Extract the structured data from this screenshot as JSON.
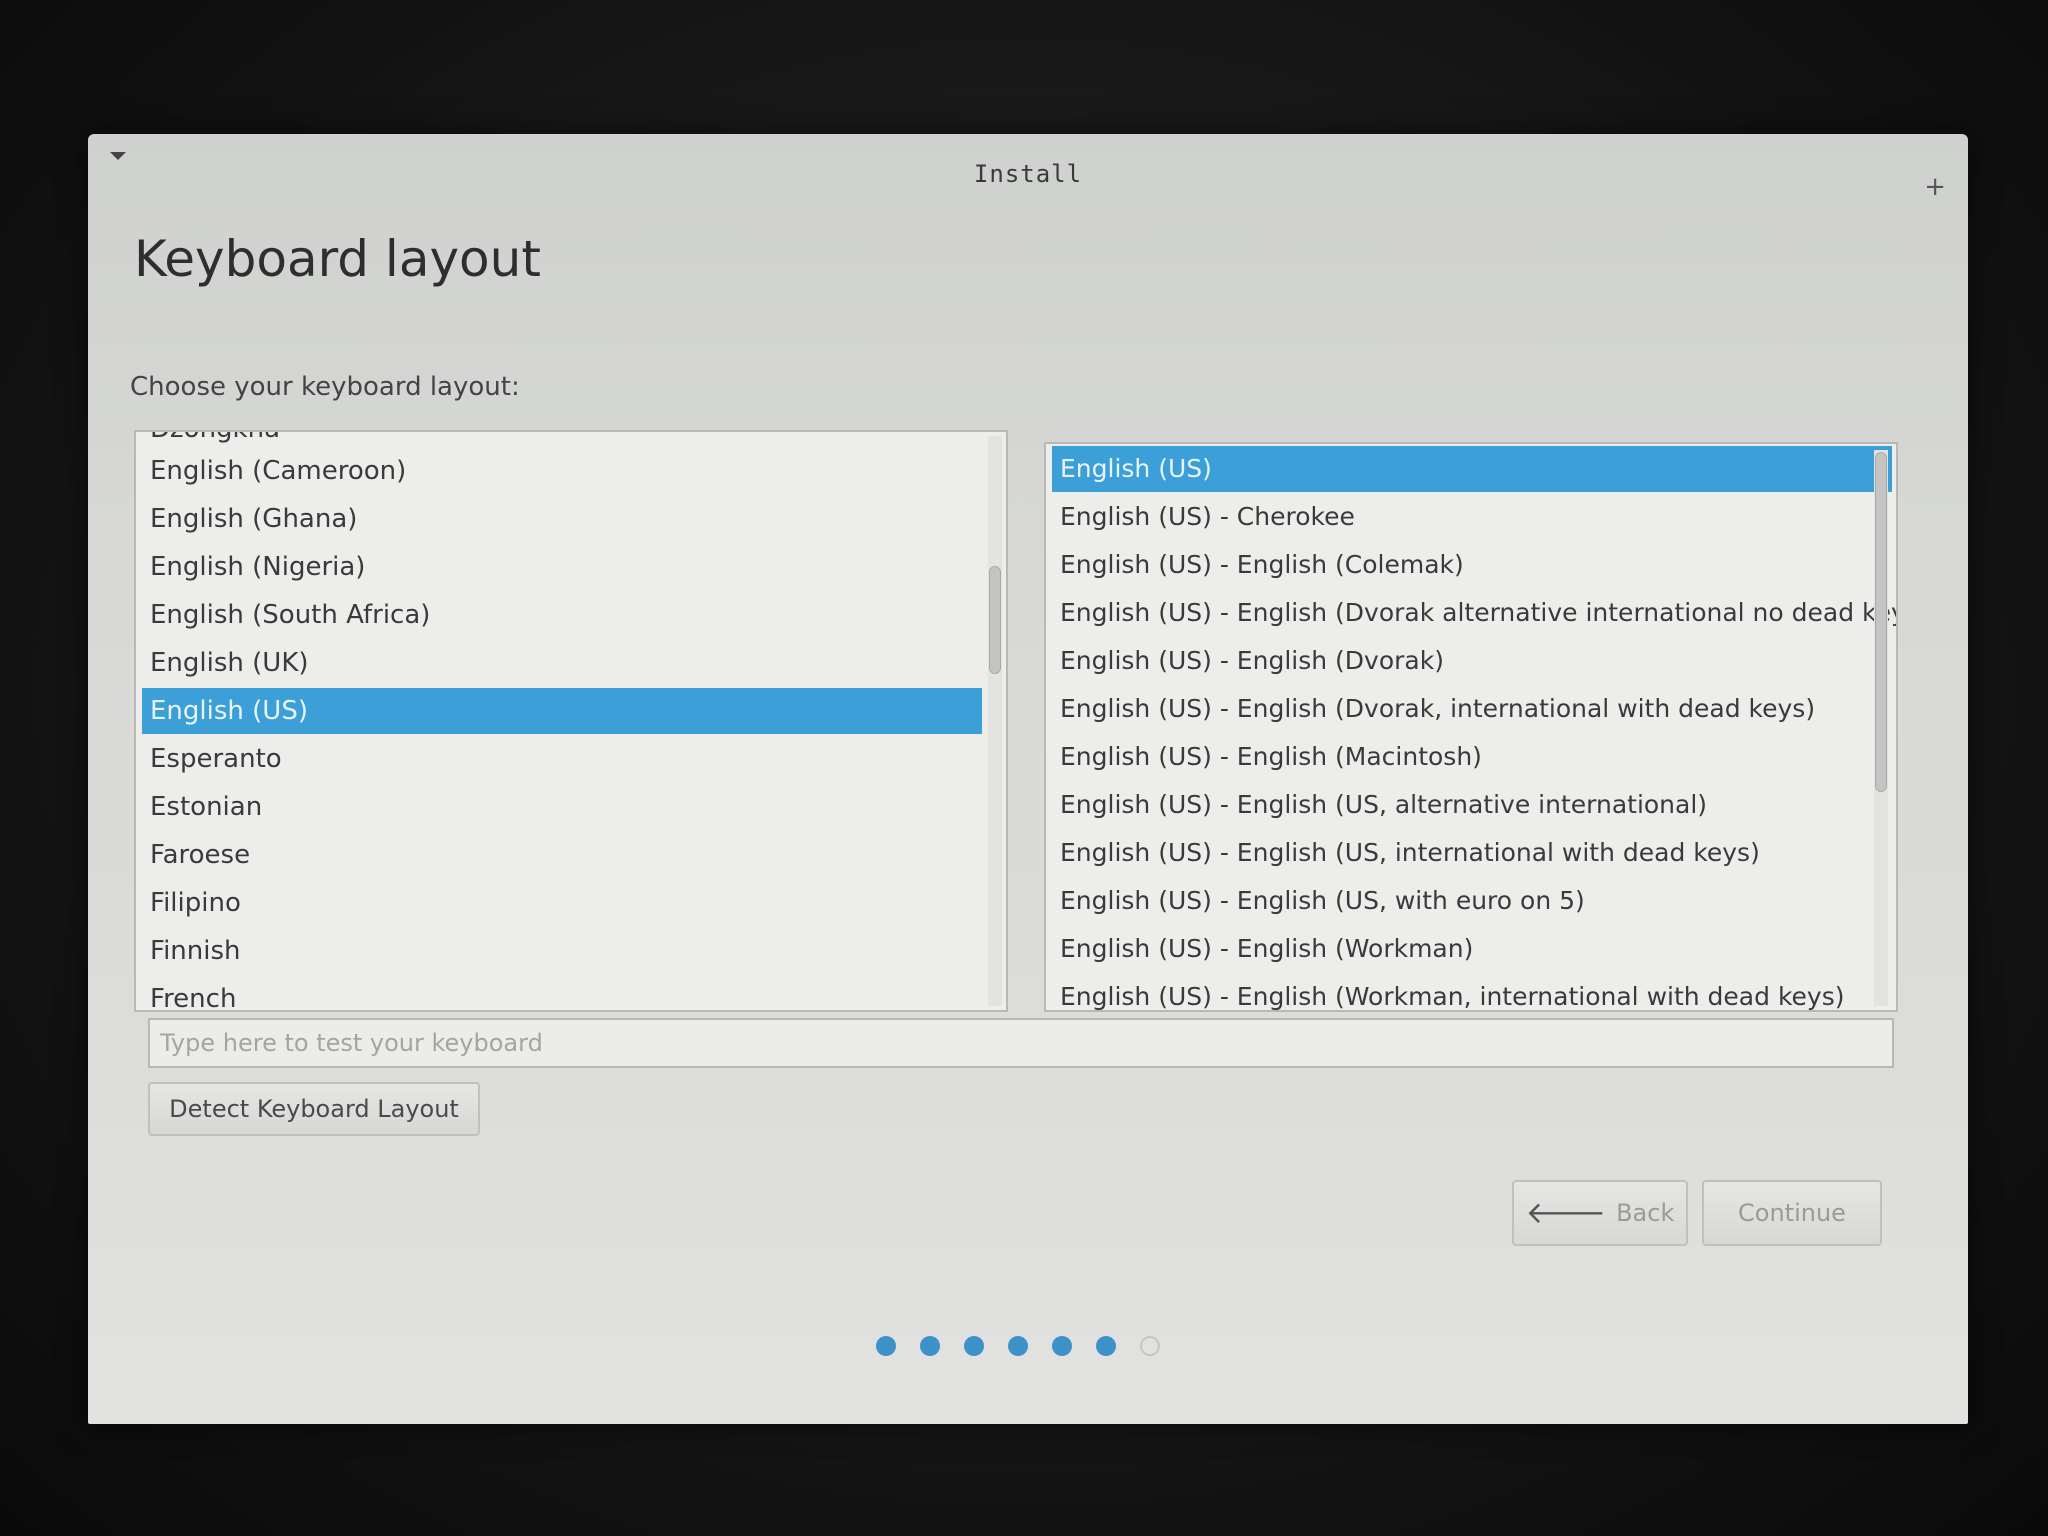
{
  "window": {
    "title": "Install",
    "close_glyph": "+"
  },
  "page": {
    "title": "Keyboard layout",
    "prompt": "Choose your keyboard layout:"
  },
  "layouts": [
    {
      "label": "Dzongkha",
      "selected": false
    },
    {
      "label": "English (Cameroon)",
      "selected": false
    },
    {
      "label": "English (Ghana)",
      "selected": false
    },
    {
      "label": "English (Nigeria)",
      "selected": false
    },
    {
      "label": "English (South Africa)",
      "selected": false
    },
    {
      "label": "English (UK)",
      "selected": false
    },
    {
      "label": "English (US)",
      "selected": true
    },
    {
      "label": "Esperanto",
      "selected": false
    },
    {
      "label": "Estonian",
      "selected": false
    },
    {
      "label": "Faroese",
      "selected": false
    },
    {
      "label": "Filipino",
      "selected": false
    },
    {
      "label": "Finnish",
      "selected": false
    },
    {
      "label": "French",
      "selected": false
    }
  ],
  "variants": [
    {
      "label": "English (US)",
      "selected": true
    },
    {
      "label": "English (US) - Cherokee",
      "selected": false
    },
    {
      "label": "English (US) - English (Colemak)",
      "selected": false
    },
    {
      "label": "English (US) - English (Dvorak alternative international no dead key",
      "selected": false
    },
    {
      "label": "English (US) - English (Dvorak)",
      "selected": false
    },
    {
      "label": "English (US) - English (Dvorak, international with dead keys)",
      "selected": false
    },
    {
      "label": "English (US) - English (Macintosh)",
      "selected": false
    },
    {
      "label": "English (US) - English (US, alternative international)",
      "selected": false
    },
    {
      "label": "English (US) - English (US, international with dead keys)",
      "selected": false
    },
    {
      "label": "English (US) - English (US, with euro on 5)",
      "selected": false
    },
    {
      "label": "English (US) - English (Workman)",
      "selected": false
    },
    {
      "label": "English (US) - English (Workman, international with dead keys)",
      "selected": false
    }
  ],
  "test_input": {
    "value": "",
    "placeholder": "Type here to test your keyboard"
  },
  "buttons": {
    "detect": "Detect Keyboard Layout",
    "back": "Back",
    "continue": "Continue"
  },
  "progress": {
    "total_steps": 7,
    "completed_steps": 6
  },
  "colors": {
    "selection": "#3d9fd8",
    "progress_dot": "#3d93c9"
  }
}
